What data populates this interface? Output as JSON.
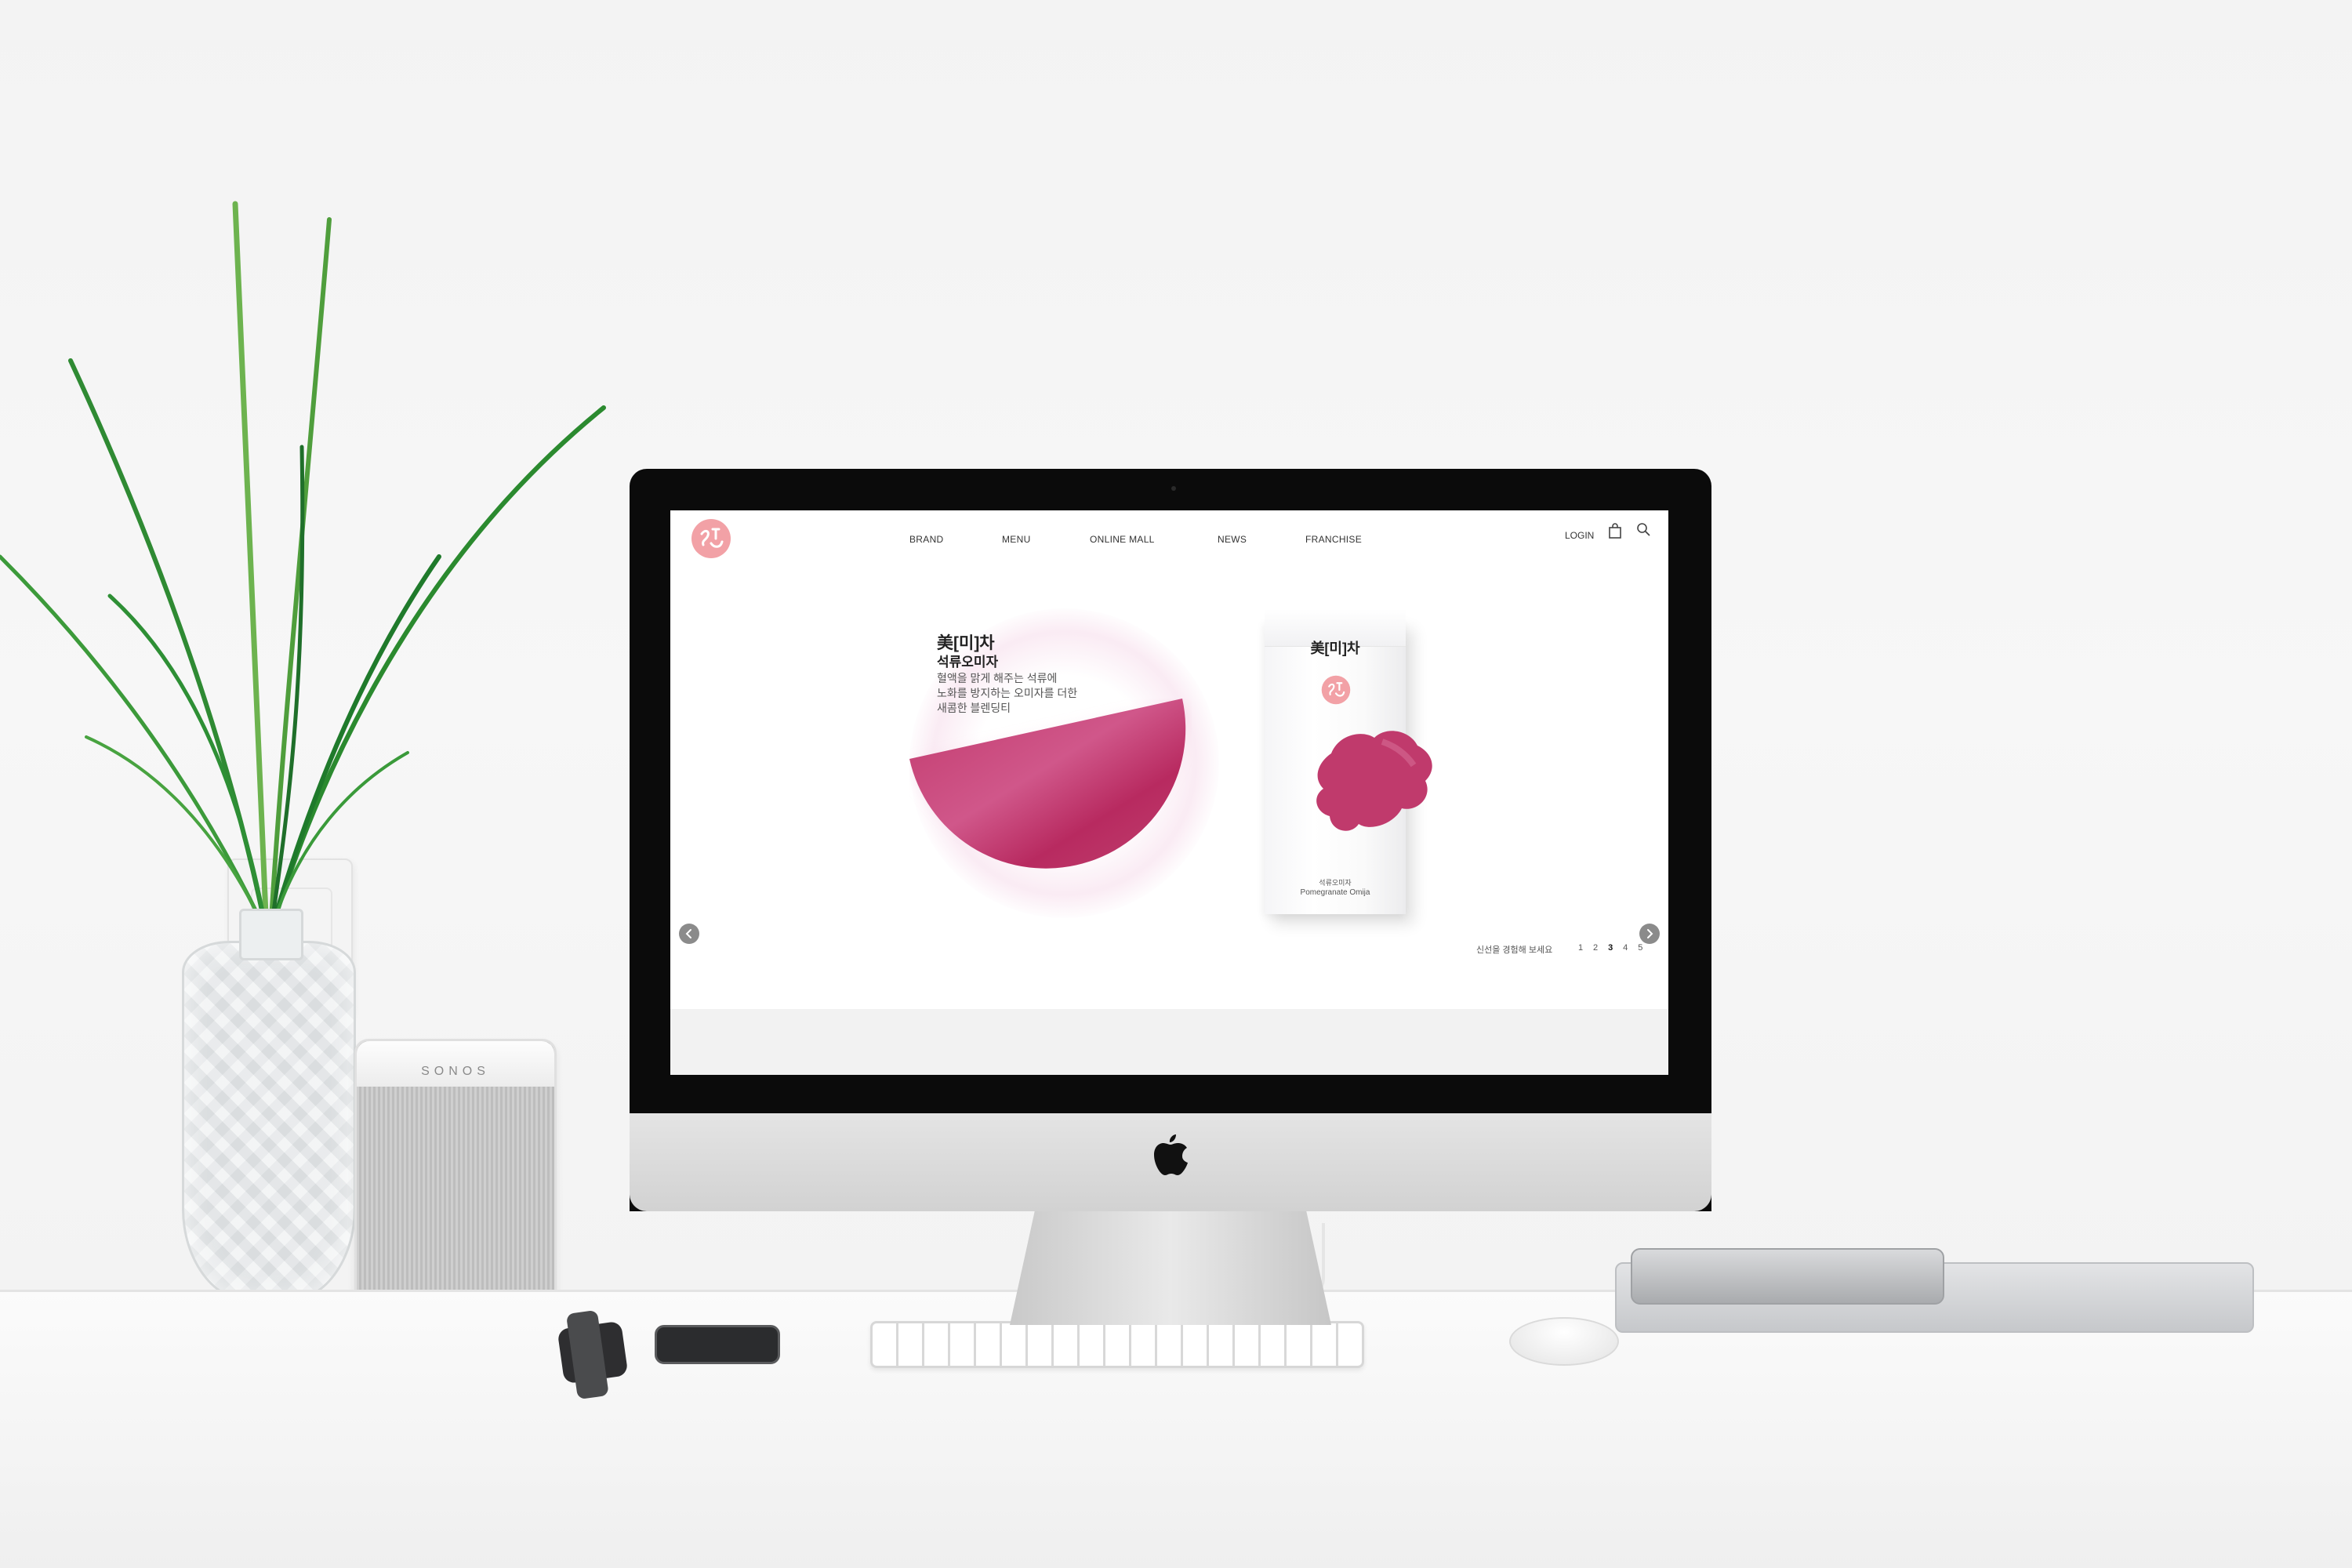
{
  "scene": {
    "speaker_brand": "SONOS"
  },
  "site": {
    "nav": [
      {
        "label": "BRAND"
      },
      {
        "label": "MENU"
      },
      {
        "label": "ONLINE MALL"
      },
      {
        "label": "NEWS"
      },
      {
        "label": "FRANCHISE"
      }
    ],
    "login_label": "LOGIN",
    "icons": {
      "logo": "brand-seal-icon",
      "cart": "shopping-bag-icon",
      "search": "search-icon"
    },
    "hero": {
      "brand": "美[미]차",
      "name": "석류오미자",
      "description": [
        "혈액을 맑게 해주는 석류에",
        "노화를 방지하는 오미자를 더한",
        "새콤한 블렌딩티"
      ]
    },
    "product": {
      "brand": "美[미]차",
      "name_kr": "석류오미자",
      "name_en": "Pomegranate Omija"
    },
    "slider": {
      "caption": "신선을 경험해 보세요",
      "pages": [
        "1",
        "2",
        "3",
        "4",
        "5"
      ],
      "active_page": "3"
    },
    "colors": {
      "accent": "#c2336b",
      "seal": "#f2a1a6"
    }
  }
}
